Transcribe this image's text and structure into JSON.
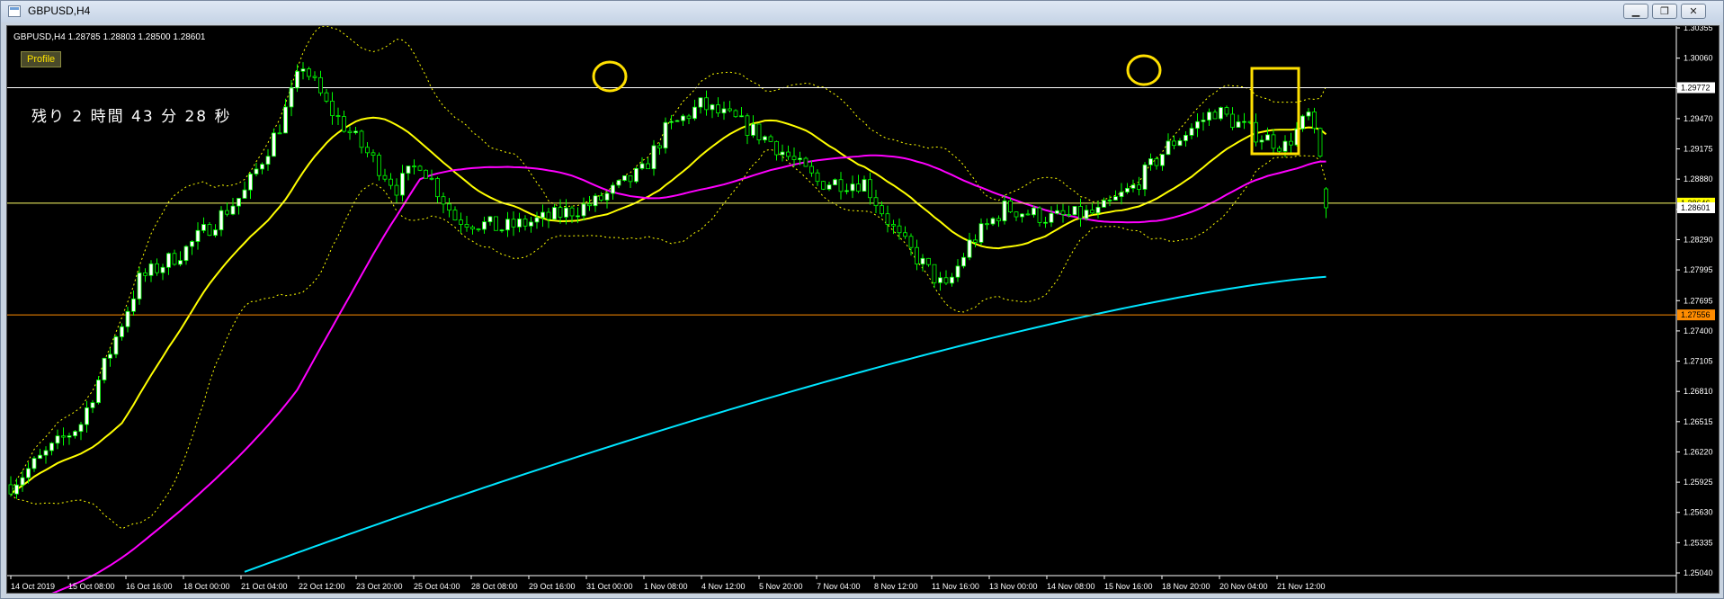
{
  "window": {
    "title": "GBPUSD,H4",
    "buttons": {
      "minimize": "▁",
      "restore": "❐",
      "close": "✕"
    }
  },
  "chart": {
    "symbol_line": "GBPUSD,H4  1.28785 1.28803 1.28500 1.28601",
    "profile_label": "Profile",
    "countdown": "残り 2 時間 43 分 28 秒"
  },
  "chart_data": {
    "type": "candlestick",
    "symbol": "GBPUSD",
    "timeframe": "H4",
    "ohlc_last": {
      "open": 1.28785,
      "high": 1.28803,
      "low": 1.285,
      "close": 1.28601
    },
    "ylim": [
      1.2504,
      1.30355
    ],
    "y_ticks": [
      "1.30355",
      "1.30060",
      "1.29765",
      "1.29470",
      "1.29175",
      "1.28880",
      "1.28585",
      "1.28290",
      "1.27995",
      "1.27695",
      "1.27400",
      "1.27105",
      "1.26810",
      "1.26515",
      "1.26220",
      "1.25925",
      "1.25630",
      "1.25335",
      "1.25040"
    ],
    "x_ticks": [
      "14 Oct 2019",
      "15 Oct 08:00",
      "16 Oct 16:00",
      "18 Oct 00:00",
      "21 Oct 04:00",
      "22 Oct 12:00",
      "23 Oct 20:00",
      "25 Oct 04:00",
      "28 Oct 08:00",
      "29 Oct 16:00",
      "31 Oct 00:00",
      "1 Nov 08:00",
      "4 Nov 12:00",
      "5 Nov 20:00",
      "7 Nov 04:00",
      "8 Nov 12:00",
      "11 Nov 16:00",
      "13 Nov 00:00",
      "14 Nov 08:00",
      "15 Nov 16:00",
      "18 Nov 20:00",
      "20 Nov 04:00",
      "21 Nov 12:00"
    ],
    "price_labels": [
      {
        "value": "1.29772",
        "color": "#ffffff",
        "text_color": "#000000"
      },
      {
        "value": "1.28646",
        "color": "#ffff00",
        "text_color": "#000000"
      },
      {
        "value": "1.28601",
        "color": "#ffffff",
        "text_color": "#000000"
      },
      {
        "value": "1.27556",
        "color": "#ff8c00",
        "text_color": "#000000"
      }
    ],
    "hlines": [
      {
        "value": 1.29772,
        "color": "#ffffff"
      },
      {
        "value": 1.28646,
        "color": "#ffff66"
      },
      {
        "value": 1.27556,
        "color": "#ff8c00"
      }
    ],
    "grid": false,
    "colors": {
      "candle_up": "#ffffff",
      "candle_down": "#00ff00",
      "ma_fast": "#ffff00",
      "ma_mid": "#ff00ff",
      "ma_slow": "#00e5ff",
      "bands": "#ffff00",
      "annotation": "#ffe000"
    }
  }
}
